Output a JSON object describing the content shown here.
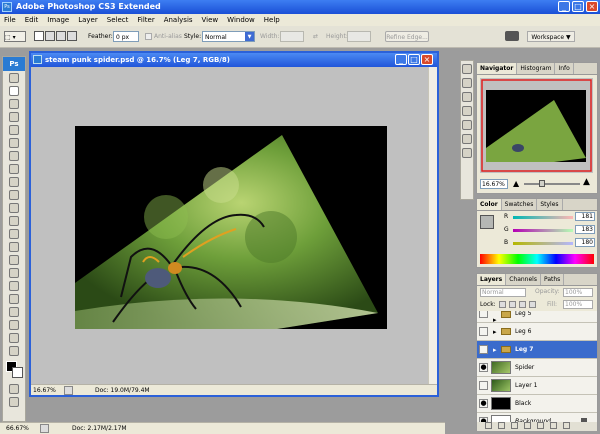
{
  "app": {
    "title": "Adobe Photoshop CS3 Extended",
    "ps_label": "Ps"
  },
  "menu": [
    "File",
    "Edit",
    "Image",
    "Layer",
    "Select",
    "Filter",
    "Analysis",
    "View",
    "Window",
    "Help"
  ],
  "options": {
    "feather_label": "Feather:",
    "feather_value": "0 px",
    "antialias_label": "Anti-alias",
    "style_label": "Style:",
    "style_value": "Normal",
    "width_label": "Width:",
    "height_label": "Height:",
    "refine_button": "Refine Edge...",
    "workspace_label": "Workspace ▼"
  },
  "document": {
    "title": "steam punk spider.psd @ 16.7% (Leg 7, RGB/8)",
    "zoom": "16.67%",
    "doc_size": "Doc: 19.0M/79.4M"
  },
  "status": {
    "zoom": "66.67%",
    "doc_size": "Doc: 2.17M/2.17M"
  },
  "navigator": {
    "tabs": [
      "Navigator",
      "Histogram",
      "Info"
    ],
    "zoom": "16.67%"
  },
  "color": {
    "tabs": [
      "Color",
      "Swatches",
      "Styles"
    ],
    "r_label": "R",
    "r_value": "181",
    "g_label": "G",
    "g_value": "183",
    "b_label": "B",
    "b_value": "180",
    "fg": "#b5b7b4",
    "bg": "#ffffff"
  },
  "layers": {
    "tabs": [
      "Layers",
      "Channels",
      "Paths"
    ],
    "blend_mode": "Normal",
    "opacity_label": "Opacity:",
    "opacity_value": "100%",
    "lock_label": "Lock:",
    "fill_label": "Fill:",
    "fill_value": "100%",
    "items": [
      {
        "name": "Leg 5",
        "group": true,
        "visible": false,
        "selected": false
      },
      {
        "name": "Leg 6",
        "group": true,
        "visible": false,
        "selected": false
      },
      {
        "name": "Leg 7",
        "group": true,
        "visible": false,
        "selected": true
      },
      {
        "name": "Spider",
        "group": false,
        "visible": true,
        "selected": false
      },
      {
        "name": "Layer 1",
        "group": false,
        "visible": false,
        "selected": false
      },
      {
        "name": "Black",
        "group": false,
        "visible": true,
        "selected": false
      },
      {
        "name": "Background",
        "group": false,
        "visible": true,
        "selected": false
      }
    ]
  }
}
